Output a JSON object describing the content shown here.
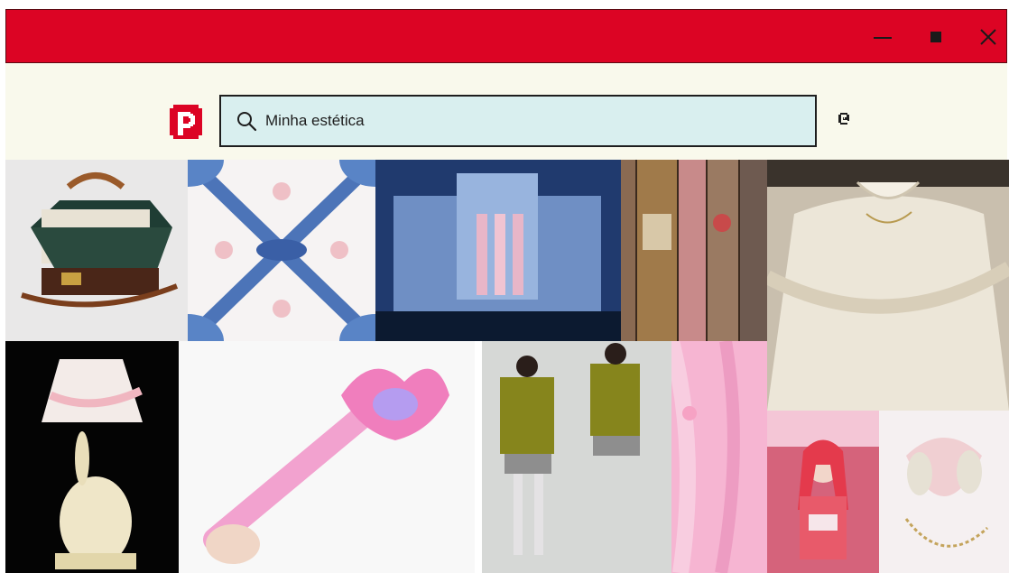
{
  "window": {
    "controls": [
      "minimize-icon",
      "maximize-icon",
      "close-icon"
    ],
    "titlebar_color": "#dc0424"
  },
  "header": {
    "logo_letter": "P",
    "logo_color": "#dc0424",
    "background": "#f9f9ec"
  },
  "search": {
    "placeholder": "Minha estética",
    "value": "",
    "icon": "search-icon",
    "background": "#d9efef"
  },
  "mention_icon": "at-sign-icon",
  "pins": [
    {
      "subject": "vintage-suitcase"
    },
    {
      "subject": "blue-bow-pattern"
    },
    {
      "subject": "blue-castle"
    },
    {
      "subject": "antique-books"
    },
    {
      "subject": "white-lace-blouse"
    },
    {
      "subject": "bunny-lamp"
    },
    {
      "subject": "pink-magic-wand"
    },
    {
      "subject": "cat-cardigan-outfit"
    },
    {
      "subject": "pink-curtains"
    },
    {
      "subject": "pink-outfit-portrait"
    },
    {
      "subject": "heart-bag"
    }
  ]
}
